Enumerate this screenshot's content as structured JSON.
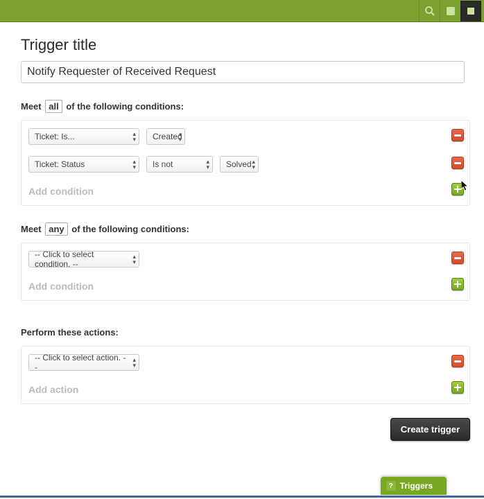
{
  "header": {
    "search_icon": "search",
    "help_icon": "help",
    "app_icon": "app"
  },
  "page": {
    "heading": "Trigger title",
    "title_value": "Notify Requester of Received Request"
  },
  "all_section": {
    "prefix": "Meet",
    "boxed": "all",
    "suffix": "of the following conditions:",
    "rows": [
      {
        "condition": "Ticket: Is...",
        "op": "Created"
      },
      {
        "condition": "Ticket: Status",
        "op": "Is not",
        "value": "Solved"
      }
    ],
    "add_label": "Add condition"
  },
  "any_section": {
    "prefix": "Meet",
    "boxed": "any",
    "suffix": "of the following conditions:",
    "rows": [
      {
        "condition": "-- Click to select condition. --"
      }
    ],
    "add_label": "Add condition"
  },
  "actions_section": {
    "label": "Perform these actions:",
    "rows": [
      {
        "action": "-- Click to select action. --"
      }
    ],
    "add_label": "Add action"
  },
  "footer": {
    "create_label": "Create trigger"
  },
  "tab": {
    "label": "Triggers"
  }
}
